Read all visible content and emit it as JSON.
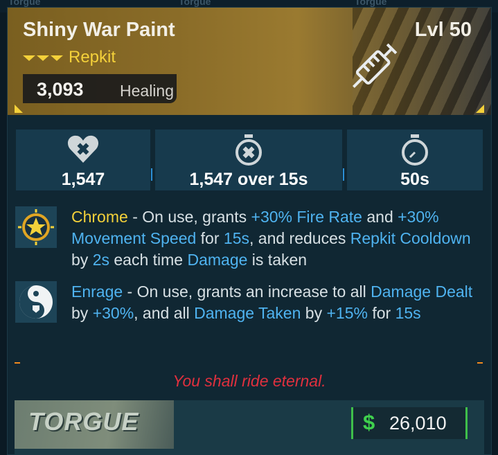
{
  "background_labels": [
    "Torgue",
    "Torgue",
    "Torgue"
  ],
  "item": {
    "name": "Shiny War Paint",
    "level": "Lvl 50",
    "rarity_label": "Repkit",
    "healing_value": "3,093",
    "healing_label": "Healing",
    "icon": "syringe-icon"
  },
  "stats": [
    {
      "icon": "heart-plus-icon",
      "value": "1,547"
    },
    {
      "icon": "timer-plus-icon",
      "value": "1,547 over 15s"
    },
    {
      "icon": "stopwatch-icon",
      "value": "50s"
    }
  ],
  "perks": [
    {
      "icon": "chrome-star-icon",
      "name": "Chrome",
      "t1": " - On use, grants ",
      "h1": "+30% Fire Rate",
      "t2": " and ",
      "h2": "+30% Movement Speed",
      "t3": " for ",
      "h3": "15s",
      "t4": ", and reduces ",
      "h4": "Repkit Cooldown",
      "t5": " by ",
      "h5": "2s",
      "t6": " each time ",
      "h6": "Damage",
      "t7": " is taken"
    },
    {
      "icon": "yin-yang-shield-icon",
      "name": "Enrage",
      "t1": " - On use, grants an increase to all ",
      "h1": "Damage Dealt",
      "t2": " by ",
      "h2": "+30%",
      "t3": ", and all ",
      "h3": "Damage Taken",
      "t4": " by ",
      "h4": "+15%",
      "t5": " for ",
      "h5": "15s"
    }
  ],
  "flavor_text": "You shall ride eternal.",
  "manufacturer": "TORGUE",
  "price": {
    "currency_symbol": "$",
    "value": "26,010"
  },
  "colors": {
    "rarity_yellow": "#f4d13a",
    "highlight_blue": "#4fb3f0",
    "flavor_red": "#e0303e",
    "price_green": "#3fbf4a"
  }
}
